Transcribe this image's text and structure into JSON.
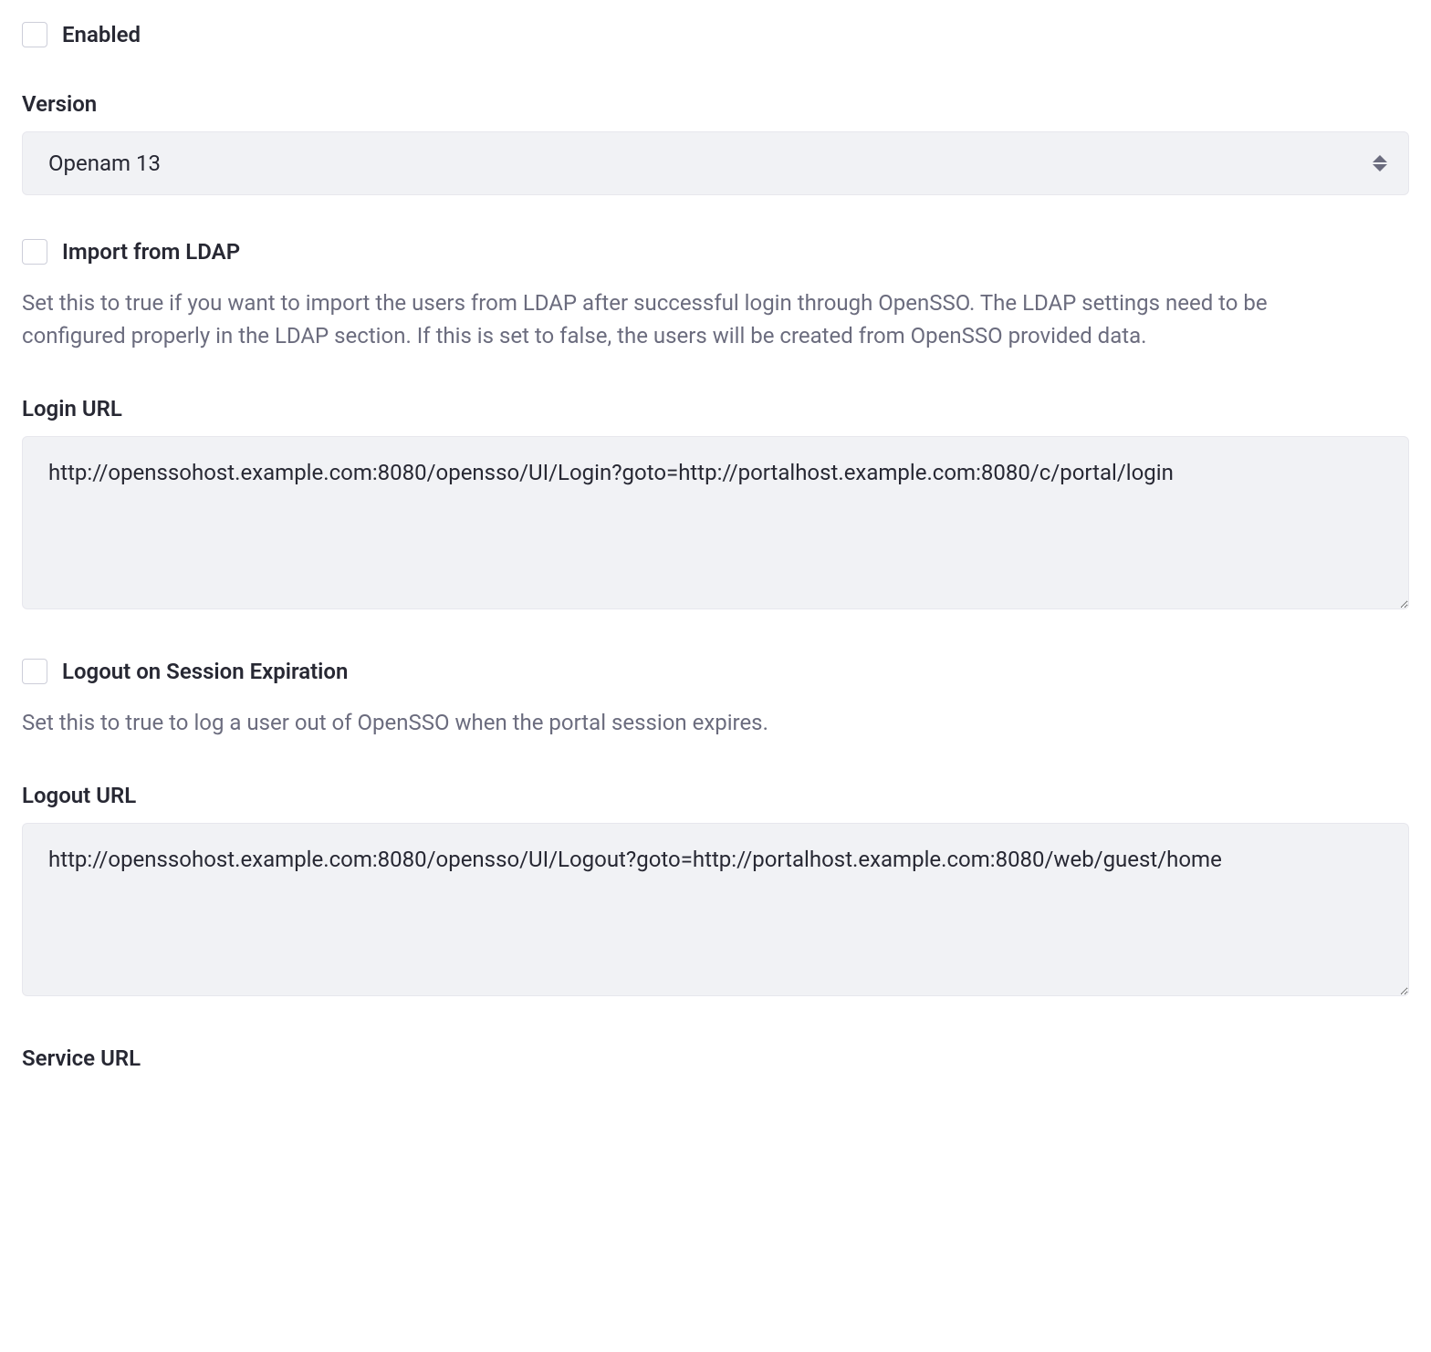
{
  "enabled": {
    "label": "Enabled",
    "checked": false
  },
  "version": {
    "label": "Version",
    "selected": "Openam 13"
  },
  "importFromLdap": {
    "label": "Import from LDAP",
    "checked": false,
    "help": "Set this to true if you want to import the users from LDAP after successful login through OpenSSO. The LDAP settings need to be configured properly in the LDAP section. If this is set to false, the users will be created from OpenSSO provided data."
  },
  "loginUrl": {
    "label": "Login URL",
    "value": "http://openssohost.example.com:8080/opensso/UI/Login?goto=http://portalhost.example.com:8080/c/portal/login"
  },
  "logoutOnSessionExpiration": {
    "label": "Logout on Session Expiration",
    "checked": false,
    "help": "Set this to true to log a user out of OpenSSO when the portal session expires."
  },
  "logoutUrl": {
    "label": "Logout URL",
    "value": "http://openssohost.example.com:8080/opensso/UI/Logout?goto=http://portalhost.example.com:8080/web/guest/home"
  },
  "serviceUrl": {
    "label": "Service URL"
  }
}
